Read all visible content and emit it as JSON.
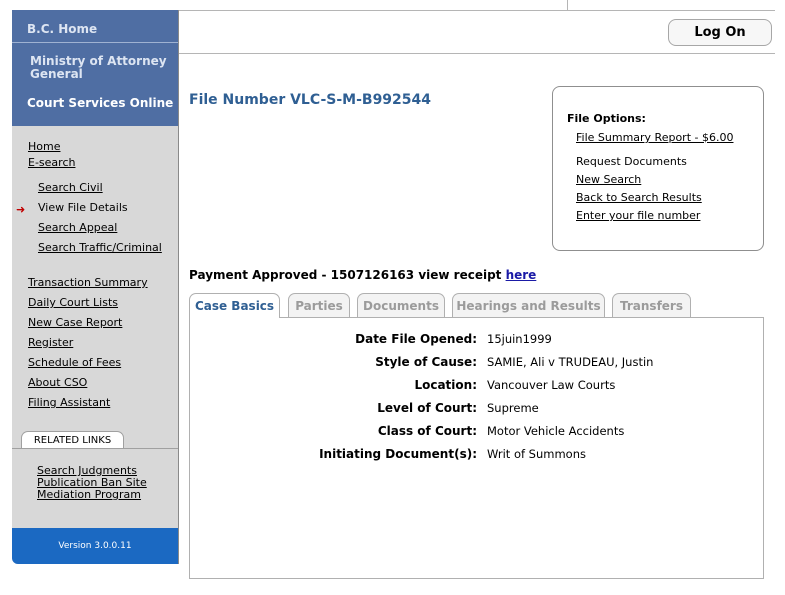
{
  "sidebar": {
    "home_link": "B.C. Home",
    "ministry": "Ministry of Attorney General",
    "service": "Court Services Online",
    "nav": {
      "home": "Home",
      "esearch": "E-search",
      "search_civil": "Search Civil",
      "view_file_details": "View File Details",
      "search_appeal": "Search Appeal",
      "search_traffic": "Search Traffic/Criminal",
      "transaction_summary": "Transaction Summary",
      "daily_court_lists": "Daily Court Lists",
      "new_case_report": "New Case Report",
      "register": "Register",
      "schedule_of_fees": "Schedule of Fees",
      "about_cso": "About CSO",
      "filing_assistant": "Filing Assistant"
    },
    "related_links_label": "RELATED LINKS",
    "related": {
      "search_judgments": "Search Judgments",
      "publication_ban_site": "Publication Ban Site",
      "mediation_program": "Mediation Program"
    },
    "version": "Version 3.0.0.11"
  },
  "header": {
    "logon_label": "Log On"
  },
  "file_number": "File Number VLC-S-M-B992544",
  "file_options": {
    "title": "File Options:",
    "summary_report": "File Summary Report - $6.00",
    "request_documents": "Request Documents",
    "new_search": "New Search",
    "back_to_results": "Back to Search Results",
    "enter_file_number": "Enter your file number"
  },
  "payment": {
    "text": "Payment Approved - 1507126163 view receipt ",
    "link": "here"
  },
  "tabs": {
    "case_basics": "Case Basics",
    "parties": "Parties",
    "documents": "Documents",
    "hearings": "Hearings and Results",
    "transfers": "Transfers"
  },
  "case_basics": {
    "date_opened": {
      "label": "Date File Opened:",
      "value": "15juin1999"
    },
    "style_of_cause": {
      "label": "Style of Cause:",
      "value": "SAMIE, Ali v TRUDEAU, Justin"
    },
    "location": {
      "label": "Location:",
      "value": "Vancouver Law Courts"
    },
    "level": {
      "label": "Level of Court:",
      "value": "Supreme"
    },
    "class": {
      "label": "Class of Court:",
      "value": "Motor Vehicle Accidents"
    },
    "initiating": {
      "label": "Initiating Document(s):",
      "value": "Writ of Summons"
    }
  }
}
